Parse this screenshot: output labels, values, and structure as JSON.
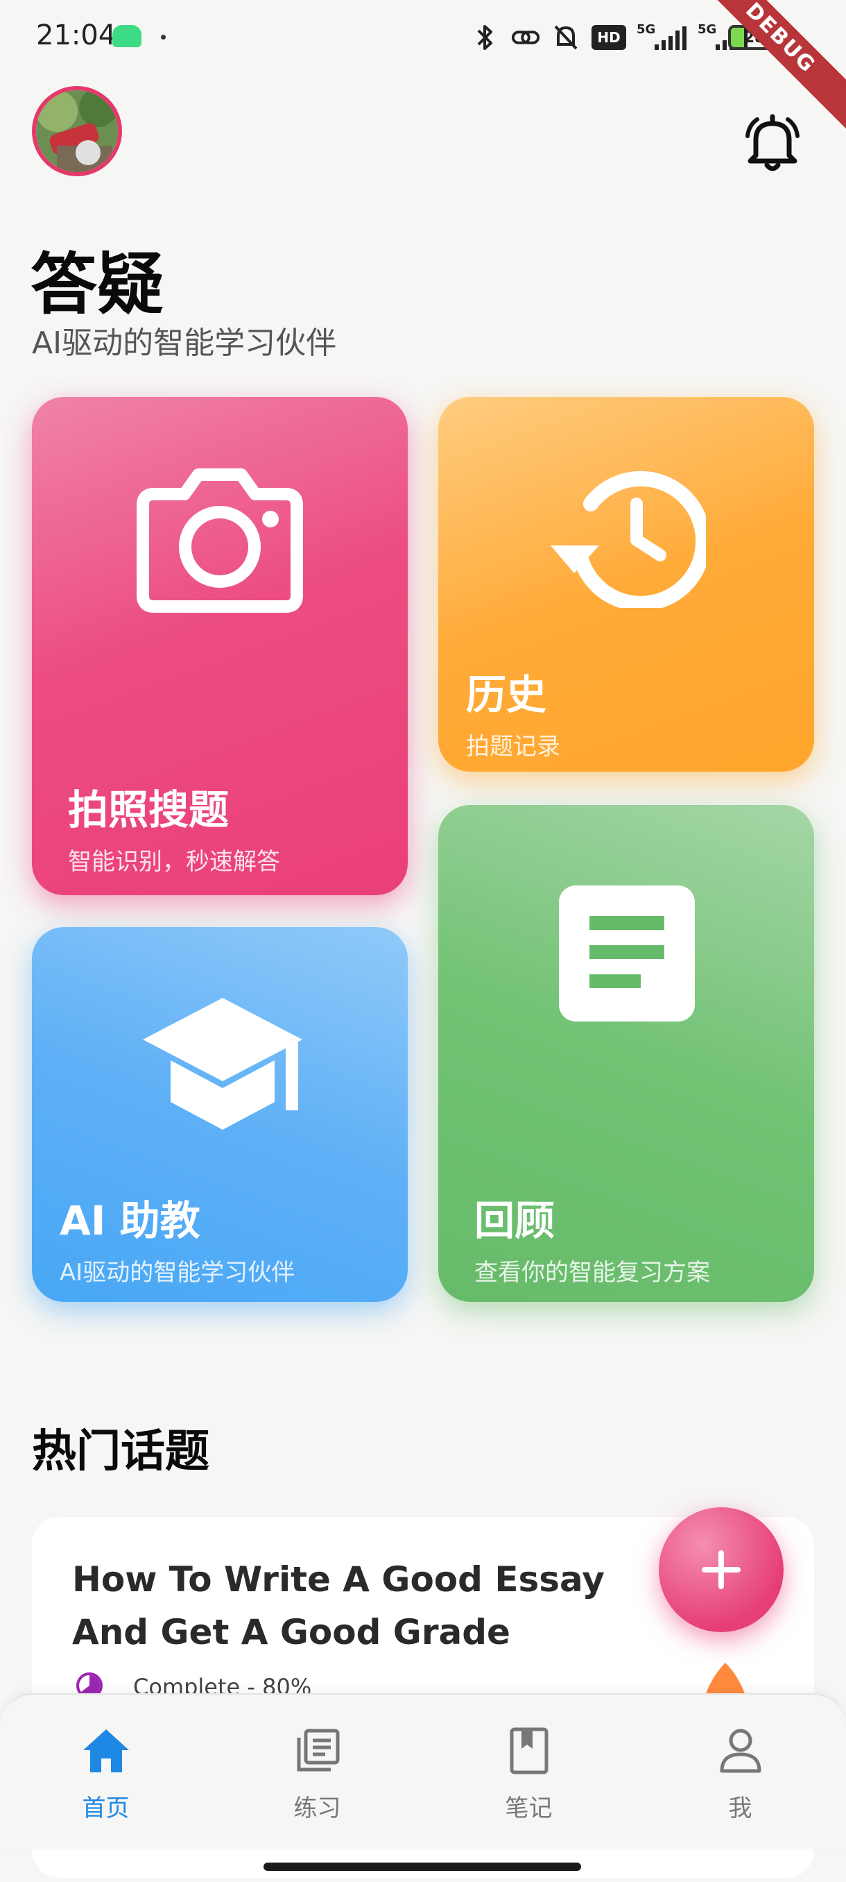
{
  "status_bar": {
    "time": "21:04",
    "battery": "28",
    "network_1": "5G",
    "network_2": "5G",
    "hd_badge": "HD",
    "debug_banner": "DEBUG"
  },
  "header": {
    "title": "答疑",
    "subtitle": "AI驱动的智能学习伙伴"
  },
  "tiles": [
    {
      "name": "拍照搜题",
      "desc": "智能识别，秒速解答",
      "icon": "camera-icon",
      "color": "#ec407a"
    },
    {
      "name": "历史",
      "desc": "拍题记录",
      "icon": "history-icon",
      "color": "#ffa726"
    },
    {
      "name": "AI 助教",
      "desc": "AI驱动的智能学习伙伴",
      "icon": "graduation-cap-icon",
      "color": "#42a5f5"
    },
    {
      "name": "回顾",
      "desc": "查看你的智能复习方案",
      "icon": "notes-icon",
      "color": "#66bb6a"
    }
  ],
  "hot_topics": {
    "heading": "热门话题",
    "card": {
      "title": "How To Write A Good Essay And Get A Good Grade",
      "progress_text": "Complete - 80%",
      "progress": 0.8
    }
  },
  "fab": {
    "icon": "plus-icon"
  },
  "nav": [
    {
      "label": "首页",
      "icon": "home-icon",
      "active": true
    },
    {
      "label": "练习",
      "icon": "library-icon",
      "active": false
    },
    {
      "label": "笔记",
      "icon": "bookmark-book-icon",
      "active": false
    },
    {
      "label": "我",
      "icon": "person-icon",
      "active": false
    }
  ]
}
